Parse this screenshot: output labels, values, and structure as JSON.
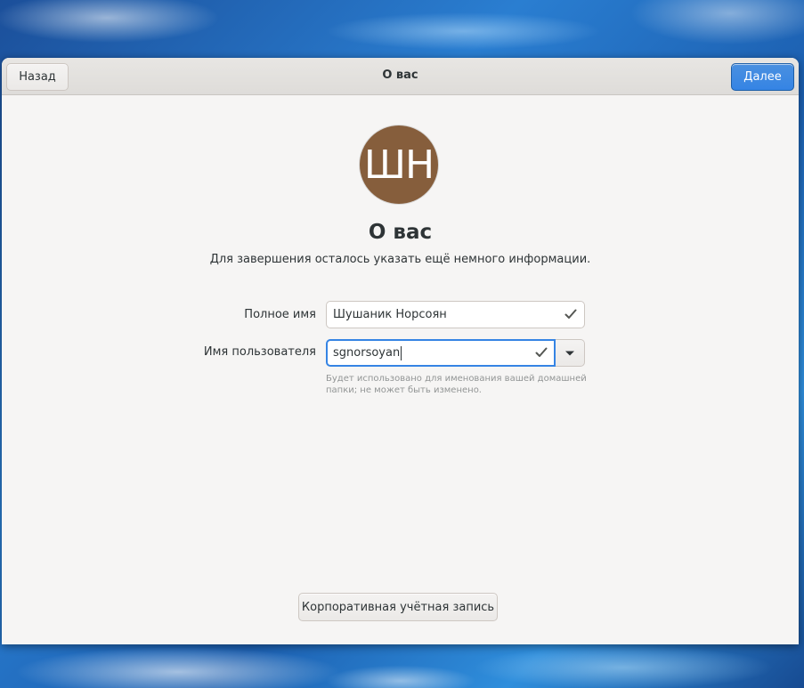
{
  "header": {
    "back_label": "Назад",
    "title": "О вас",
    "next_label": "Далее"
  },
  "avatar": {
    "initials": "ШН",
    "color": "#865e3c"
  },
  "main": {
    "heading": "О вас",
    "subtitle": "Для завершения осталось указать ещё немного информации."
  },
  "form": {
    "fullname_label": "Полное имя",
    "fullname_value": "Шушаник Норсоян",
    "username_label": "Имя пользователя",
    "username_value": "sgnorsoyan",
    "username_hint": "Будет использовано для именования вашей домашней папки; не может быть изменено."
  },
  "footer": {
    "enterprise_label": "Корпоративная учётная запись"
  },
  "colors": {
    "accent": "#3584e4",
    "window_bg": "#f6f5f4"
  },
  "icons": [
    "check-icon",
    "chevron-down-icon"
  ]
}
